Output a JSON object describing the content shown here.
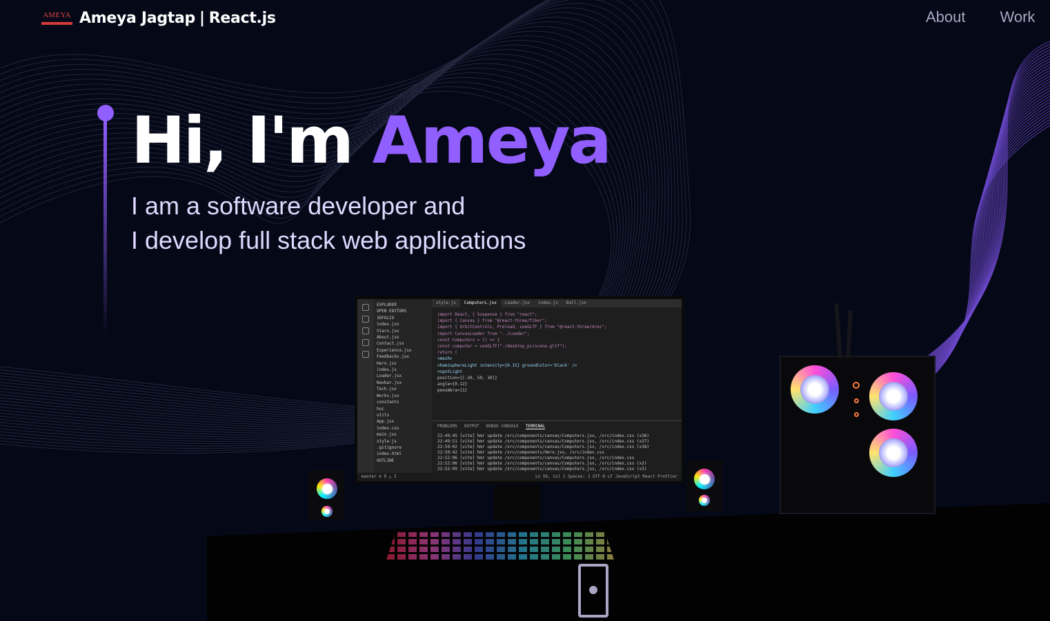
{
  "navbar": {
    "logo_text": "AMEYA",
    "brand_name": "Ameya Jagtap",
    "brand_separator": "|",
    "brand_tech": "React.js",
    "links": [
      {
        "label": "About"
      },
      {
        "label": "Work"
      }
    ]
  },
  "hero": {
    "greeting": "Hi, I'm ",
    "name": "Ameya",
    "subtitle_line1": "I am a software developer and",
    "subtitle_line2": "I develop full stack web applications"
  },
  "colors": {
    "background": "#050816",
    "accent": "#915eff",
    "nav_text": "#aaa6c3",
    "subtitle_text": "#dfd9ff"
  },
  "screen": {
    "tabs": [
      "style.js",
      "Computers.jsx",
      "Loader.jsx",
      "index.js",
      "Ball.jsx"
    ],
    "explorer": [
      "EXPLORER",
      "OPEN EDITORS",
      "3DFOLIO",
      "index.jsx",
      "Stars.jsx",
      "About.jsx",
      "Contact.jsx",
      "Experience.jsx",
      "Feedbacks.jsx",
      "Hero.jsx",
      "index.js",
      "Loader.jsx",
      "Navbar.jsx",
      "Tech.jsx",
      "Works.jsx",
      "constants",
      "hoc",
      "utils",
      "App.jsx",
      "index.css",
      "main.jsx",
      "style.js",
      ".gitignore",
      "index.html",
      "OUTLINE"
    ],
    "code": [
      "import React, { Suspense } from \"react\";",
      "import { Canvas } from \"@react-three/fiber\";",
      "import { OrbitControls, Preload, useGLTF } from \"@react-three/drei\";",
      "",
      "import CanvasLoader from \"../Loader\";",
      "",
      "const Computers = () => {",
      "  const computer = useGLTF(\"./desktop_pc/scene.gltf\");",
      "",
      "  return (",
      "    <mesh>",
      "      <hemisphereLight intensity={0.15} groundColor='black' />",
      "      <spotLight",
      "        position={[-20, 50, 10]}",
      "        angle={0.12}",
      "        penumbra={1}"
    ],
    "panel_tabs": [
      "PROBLEMS",
      "OUTPUT",
      "DEBUG CONSOLE",
      "TERMINAL"
    ],
    "terminal": [
      "22:49:45 [vite] hmr update /src/components/canvas/Computers.jsx, /src/index.css (x36)",
      "22:49:51 [vite] hmr update /src/components/canvas/Computers.jsx, /src/index.css (x37)",
      "22:50:02 [vite] hmr update /src/components/canvas/Computers.jsx, /src/index.css (x38)",
      "22:50:42 [vite] hmr update /src/components/Hero.jsx, /src/index.css",
      "22:52:06 [vite] hmr update /src/components/canvas/Computers.jsx, /src/index.css",
      "22:52:06 [vite] hmr update /src/components/canvas/Computers.jsx, /src/index.css (x2)",
      "22:52:09 [vite] hmr update /src/components/canvas/Computers.jsx, /src/index.css (x3)"
    ],
    "status_left": "master  ⊗ 0 △ 2",
    "status_right": "Ln 56, Col 1  Spaces: 2  UTF-8  LF  JavaScript React  Prettier"
  }
}
